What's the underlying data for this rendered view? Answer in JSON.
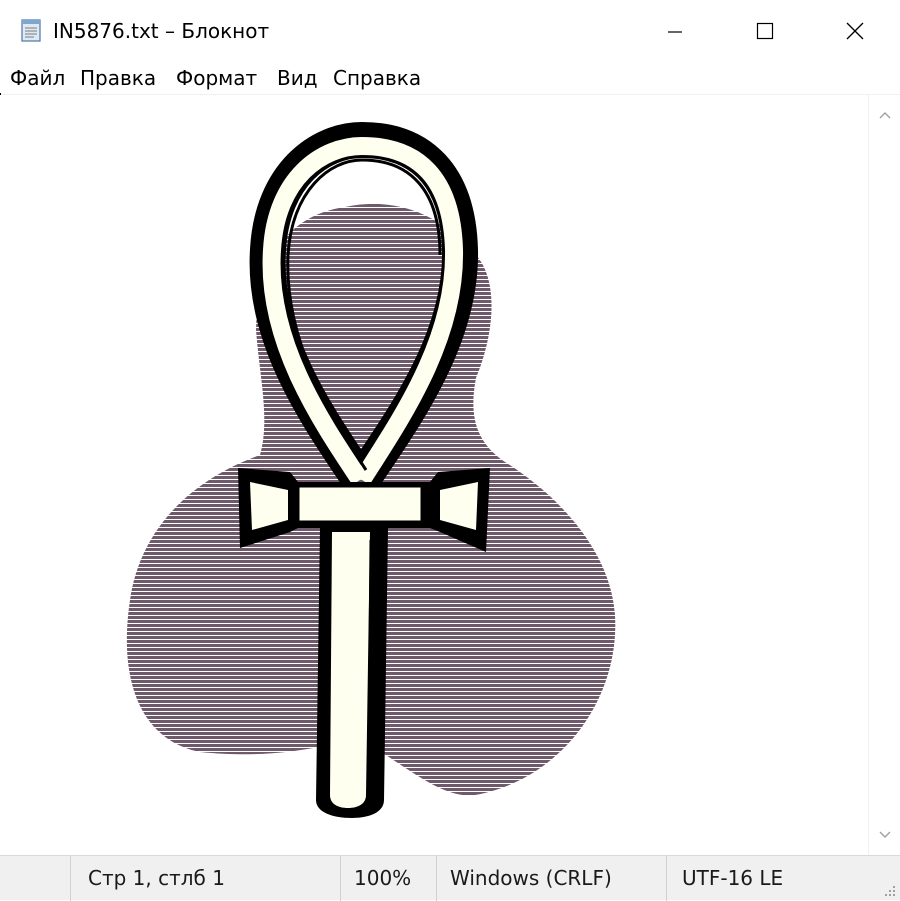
{
  "window": {
    "title": "IN5876.txt – Блокнот",
    "icon": "notepad-icon",
    "controls": [
      "minimize-icon",
      "maximize-icon",
      "close-icon"
    ]
  },
  "menu": {
    "items": [
      "Файл",
      "Правка",
      "Формат",
      "Вид",
      "Справка"
    ]
  },
  "editor": {
    "content_art": "ankh-on-trefoil-ascii-art",
    "colors": {
      "trefoil": "#6e5a6a",
      "ankh_fill": "#fffff0",
      "outline": "#000000"
    }
  },
  "scrollbar": {
    "up_icon": "chevron-up-icon",
    "down_icon": "chevron-down-icon"
  },
  "status": {
    "position": "Стр 1, стлб 1",
    "zoom": "100%",
    "line_ending": "Windows (CRLF)",
    "encoding": "UTF-16 LE"
  }
}
